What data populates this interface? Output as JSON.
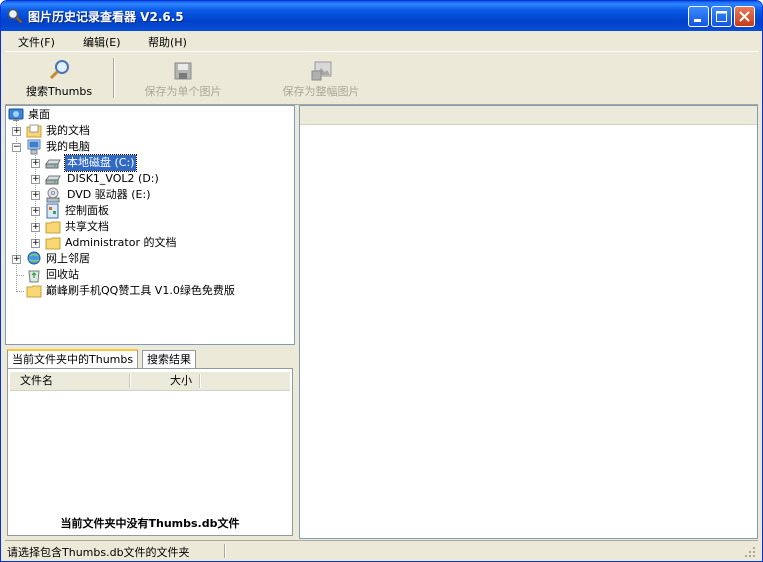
{
  "window": {
    "title": "图片历史记录查看器 V2.6.5",
    "title_color": "#0a5ae6",
    "close_color": "#c63a16"
  },
  "menu": {
    "file": "文件(F)",
    "edit": "编辑(E)",
    "help": "帮助(H)"
  },
  "toolbar": {
    "search_label": "搜索Thumbs",
    "save_single_label": "保存为单个图片",
    "save_whole_label": "保存为整幅图片",
    "search_icon": "magnifier-icon",
    "save_single_icon": "floppy-disk-icon",
    "save_whole_icon": "save-image-icon"
  },
  "tree": {
    "desktop": "桌面",
    "my_documents": "我的文档",
    "my_computer": "我的电脑",
    "local_disk": "本地磁盘 (C:)",
    "disk1": "DISK1_VOL2 (D:)",
    "dvd": "DVD 驱动器 (E:)",
    "control_panel": "控制面板",
    "shared_docs": "共享文档",
    "admin_docs": "Administrator 的文档",
    "network": "网上邻居",
    "recycle_bin": "回收站",
    "folder_tool": "巅峰刷手机QQ赞工具 V1.0绿色免费版",
    "selection_color": "#316ac5"
  },
  "tabs": {
    "current_folder": "当前文件夹中的Thumbs",
    "search_results": "搜索结果"
  },
  "list": {
    "col_filename": "文件名",
    "col_size": "大小",
    "empty_message": "当前文件夹中没有Thumbs.db文件"
  },
  "status": {
    "text": "请选择包含Thumbs.db文件的文件夹"
  }
}
